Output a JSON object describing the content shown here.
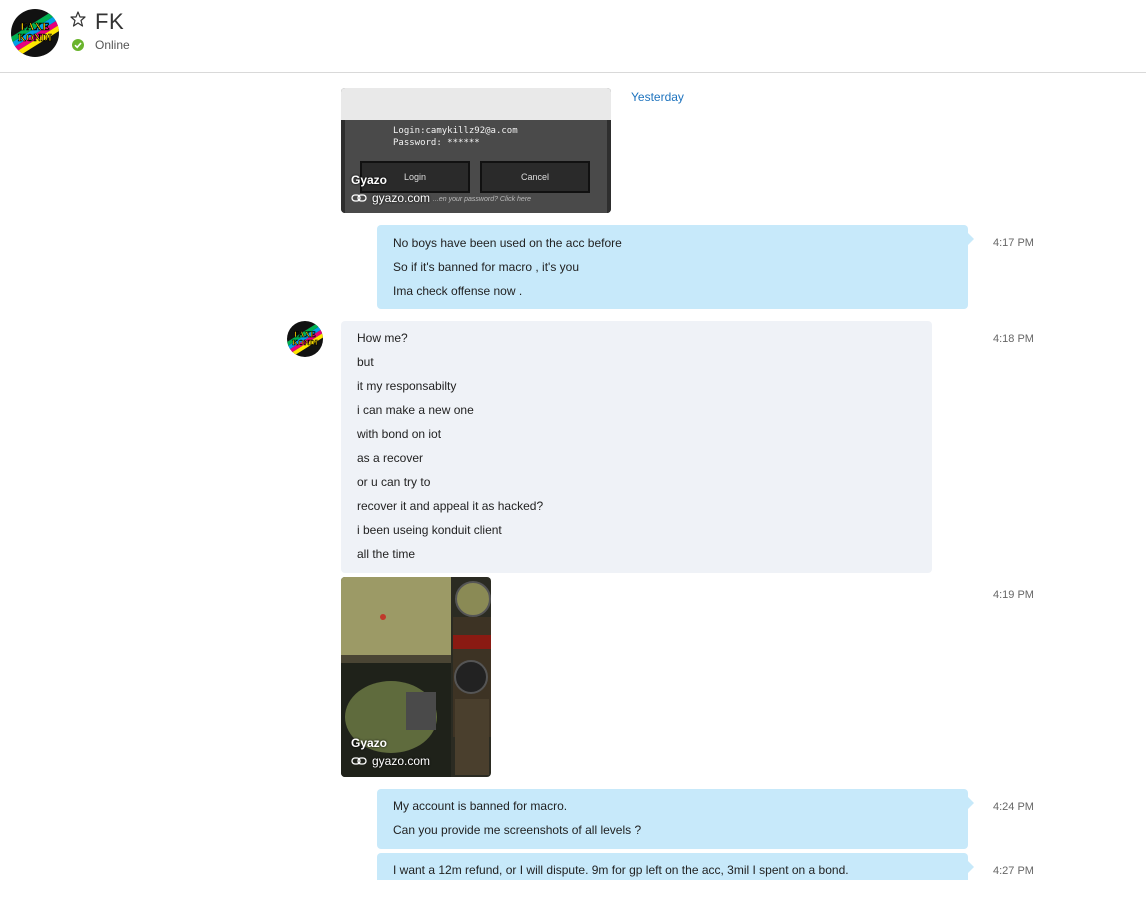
{
  "header": {
    "contact_name": "FK",
    "presence": "Online",
    "avatar_text_top": "FAXE",
    "avatar_text_bottom": "KONDI"
  },
  "conversation": {
    "date_separator": "Yesterday",
    "card1": {
      "brand": "Gyazo",
      "link": "gyazo.com",
      "login_text": "Login:camykillz92@a.com",
      "password_text": "Password: ******",
      "login_button": "Login",
      "cancel_button": "Cancel",
      "forgot_text": "...en your password? Click here"
    },
    "msg1": {
      "lines": [
        "No boys have been used on the acc before",
        "So if it's banned for macro , it's you",
        "Ima check offense now ."
      ],
      "time": "4:17 PM"
    },
    "msg2": {
      "lines": [
        "How me?",
        "but",
        "it my responsabilty",
        "i can make a new one",
        "with bond on iot",
        "as a recover",
        "or u can try to",
        "recover it and appeal it as hacked?",
        "i been useing konduit client",
        "all the time"
      ],
      "time": "4:18 PM"
    },
    "card2": {
      "brand": "Gyazo",
      "link": "gyazo.com",
      "time": "4:19 PM"
    },
    "msg3": {
      "lines": [
        "My account is banned for macro.",
        "Can you provide me screenshots of all levels ?"
      ],
      "time": "4:24 PM"
    },
    "msg4": {
      "lines": [
        "I want a 12m refund, or I will dispute. 9m for gp left on the acc, 3mil I spent on a bond."
      ],
      "time": "4:27 PM"
    }
  },
  "colors": {
    "outgoing_bubble": "#c7e9fa",
    "incoming_bubble": "#eff2f7",
    "link_blue": "#1e73be",
    "presence_green": "#6ab42d"
  }
}
